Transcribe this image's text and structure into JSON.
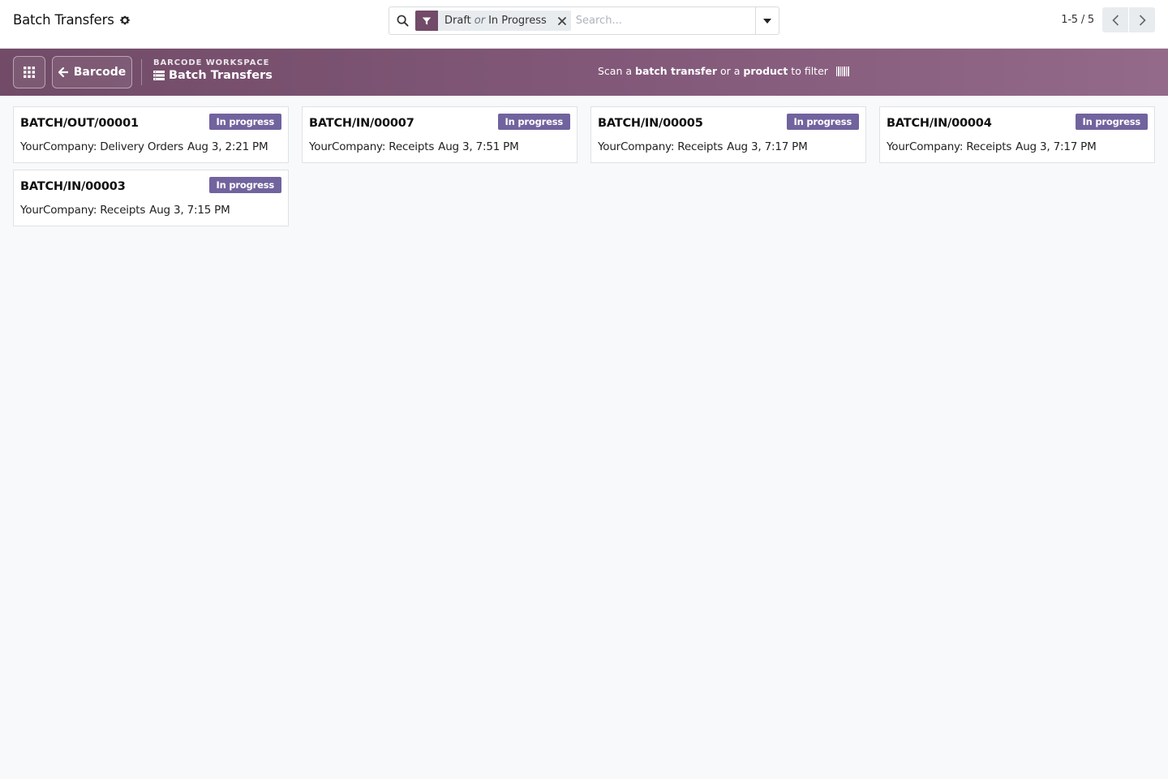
{
  "control_panel": {
    "title": "Batch Transfers",
    "search": {
      "facet_values": [
        "Draft",
        "In Progress"
      ],
      "facet_separator": "or",
      "placeholder": "Search..."
    },
    "pager": {
      "value": "1-5 / 5"
    }
  },
  "barcode_bar": {
    "back_label": "Barcode",
    "breadcrumb_super": "BARCODE WORKSPACE",
    "breadcrumb_title": "Batch Transfers",
    "scan_hint": {
      "prefix": "Scan a ",
      "term1": "batch transfer",
      "middle": " or a ",
      "term2": "product",
      "suffix": " to filter"
    }
  },
  "records": [
    {
      "name": "BATCH/OUT/00001",
      "state": "In progress",
      "picking_type": "YourCompany: Delivery Orders",
      "date": "Aug 3, 2:21 PM"
    },
    {
      "name": "BATCH/IN/00007",
      "state": "In progress",
      "picking_type": "YourCompany: Receipts",
      "date": "Aug 3, 7:51 PM"
    },
    {
      "name": "BATCH/IN/00005",
      "state": "In progress",
      "picking_type": "YourCompany: Receipts",
      "date": "Aug 3, 7:17 PM"
    },
    {
      "name": "BATCH/IN/00004",
      "state": "In progress",
      "picking_type": "YourCompany: Receipts",
      "date": "Aug 3, 7:17 PM"
    },
    {
      "name": "BATCH/IN/00003",
      "state": "In progress",
      "picking_type": "YourCompany: Receipts",
      "date": "Aug 3, 7:15 PM"
    }
  ],
  "colors": {
    "brand": "#714b67",
    "badge": "#71639e",
    "background": "#f8f9fa"
  },
  "icons": [
    "gear-icon",
    "search-icon",
    "filter-icon",
    "close-icon",
    "caret-down-icon",
    "chevron-left-icon",
    "chevron-right-icon",
    "apps-grid-icon",
    "arrow-left-icon",
    "batch-list-icon",
    "barcode-icon"
  ]
}
